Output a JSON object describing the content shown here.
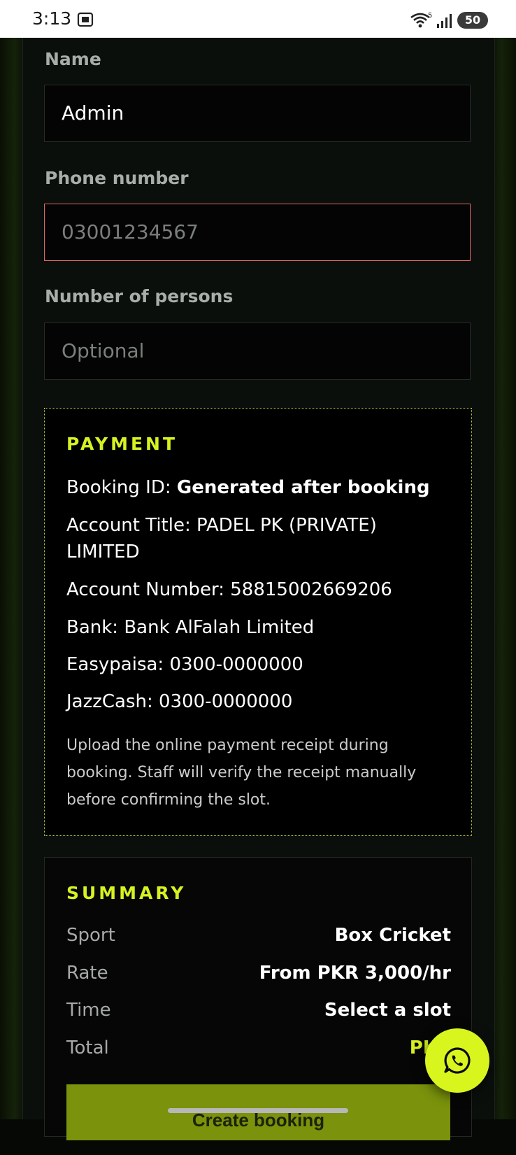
{
  "status_bar": {
    "time": "3:13",
    "screen_icon": "screenshot-icon",
    "wifi_icon": "wifi-icon",
    "wifi_badge": "5",
    "signal_icon": "signal-icon",
    "battery": "50"
  },
  "form": {
    "name_label": "Name",
    "name_value": "Admin",
    "phone_label": "Phone number",
    "phone_placeholder": "03001234567",
    "persons_label": "Number of persons",
    "persons_placeholder": "Optional"
  },
  "payment": {
    "title": "PAYMENT",
    "booking_id_label": "Booking ID: ",
    "booking_id_value": "Generated after booking",
    "account_title": "Account Title: PADEL PK (PRIVATE) LIMITED",
    "account_number": "Account Number: 58815002669206",
    "bank": "Bank: Bank AlFalah Limited",
    "easypaisa": "Easypaisa: 0300-0000000",
    "jazzcash": "JazzCash: 0300-0000000",
    "note": "Upload the online payment receipt during booking. Staff will verify the receipt manually before confirming the slot."
  },
  "summary": {
    "title": "SUMMARY",
    "rows": [
      {
        "key": "Sport",
        "value": "Box Cricket"
      },
      {
        "key": "Rate",
        "value": "From PKR 3,000/hr"
      },
      {
        "key": "Time",
        "value": "Select a slot"
      },
      {
        "key": "Total",
        "value": "PKR"
      }
    ],
    "button_label": "Create booking"
  },
  "colors": {
    "accent": "#d7f221",
    "error_border": "#e06a62",
    "button_bg": "#7a920c"
  },
  "floating": {
    "icon": "whatsapp-icon"
  }
}
